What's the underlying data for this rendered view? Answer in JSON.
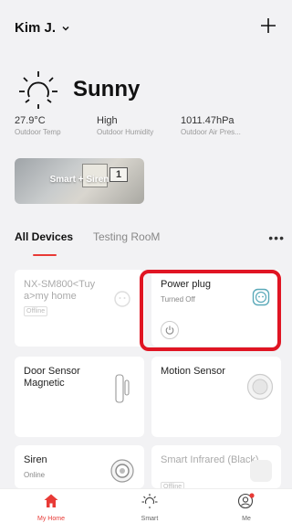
{
  "header": {
    "home_name": "Kim J."
  },
  "weather": {
    "condition": "Sunny",
    "metrics": [
      {
        "value": "27.9°C",
        "label": "Outdoor Temp"
      },
      {
        "value": "High",
        "label": "Outdoor Humidity"
      },
      {
        "value": "1011.47hPa",
        "label": "Outdoor Air Pres..."
      }
    ]
  },
  "scene": {
    "label": "Smart + Siren",
    "badge": "1"
  },
  "tabs": {
    "all": "All Devices",
    "room": "Testing RooM",
    "more": "•••"
  },
  "devices": [
    {
      "name": "NX-SM800<Tuy a>my home",
      "status": "Offline"
    },
    {
      "name": "Power plug",
      "status": "Turned Off"
    },
    {
      "name": "Door Sensor Magnetic"
    },
    {
      "name": "Motion Sensor"
    },
    {
      "name": "Siren",
      "status": "Online"
    },
    {
      "name": "Smart Infrared (Black)",
      "status": "Offline"
    }
  ],
  "nav": [
    {
      "label": "My Home"
    },
    {
      "label": "Smart"
    },
    {
      "label": "Me"
    }
  ],
  "colors": {
    "accent": "#e83a36",
    "highlight": "#e01523",
    "icon_teal": "#5aa9b9"
  }
}
